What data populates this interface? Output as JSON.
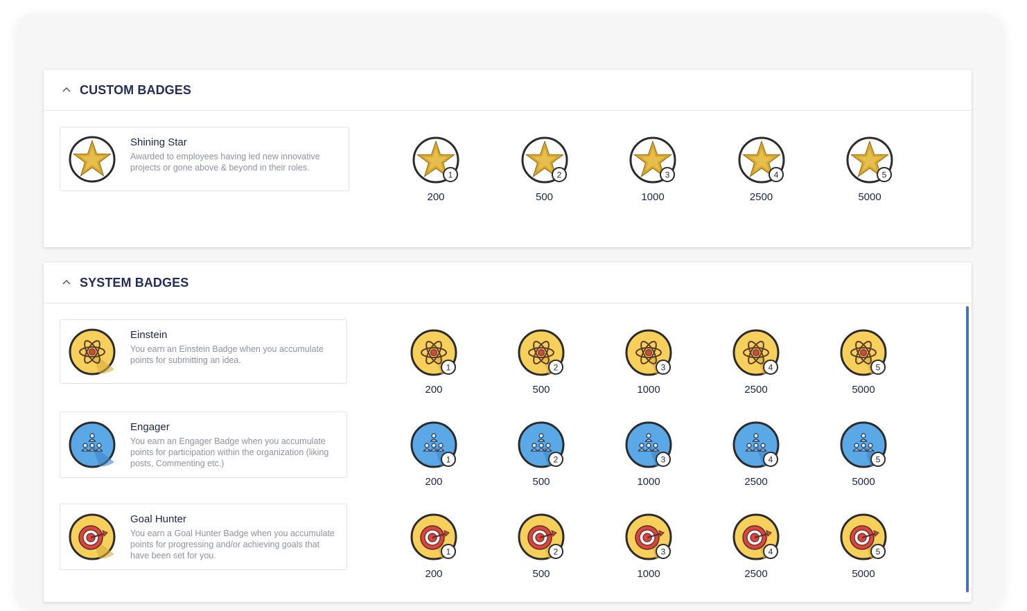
{
  "custom_section": {
    "title": "CUSTOM BADGES",
    "badges": [
      {
        "name": "Shining Star",
        "description": "Awarded to employees having led new innovative projects or gone above & beyond in their roles.",
        "icon": "star-badge-icon",
        "levels": [
          {
            "level": "1",
            "points": "200"
          },
          {
            "level": "2",
            "points": "500"
          },
          {
            "level": "3",
            "points": "1000"
          },
          {
            "level": "4",
            "points": "2500"
          },
          {
            "level": "5",
            "points": "5000"
          }
        ]
      }
    ]
  },
  "system_section": {
    "title": "SYSTEM BADGES",
    "badges": [
      {
        "name": "Einstein",
        "description": "You earn an Einstein Badge when you accumulate points for submitting an idea.",
        "icon": "atom-badge-icon",
        "levels": [
          {
            "level": "1",
            "points": "200"
          },
          {
            "level": "2",
            "points": "500"
          },
          {
            "level": "3",
            "points": "1000"
          },
          {
            "level": "4",
            "points": "2500"
          },
          {
            "level": "5",
            "points": "5000"
          }
        ]
      },
      {
        "name": "Engager",
        "description": "You earn an Engager Badge when you accumulate points for participation within the organization (liking posts, Commenting etc.)",
        "icon": "people-badge-icon",
        "levels": [
          {
            "level": "1",
            "points": "200"
          },
          {
            "level": "2",
            "points": "500"
          },
          {
            "level": "3",
            "points": "1000"
          },
          {
            "level": "4",
            "points": "2500"
          },
          {
            "level": "5",
            "points": "5000"
          }
        ]
      },
      {
        "name": "Goal Hunter",
        "description": "You earn a Goal Hunter Badge when you accumulate points for progressing and/or achieving goals that have been set for you.",
        "icon": "target-badge-icon",
        "levels": [
          {
            "level": "1",
            "points": "200"
          },
          {
            "level": "2",
            "points": "500"
          },
          {
            "level": "3",
            "points": "1000"
          },
          {
            "level": "4",
            "points": "2500"
          },
          {
            "level": "5",
            "points": "5000"
          }
        ]
      }
    ]
  },
  "colors": {
    "title": "#242c5a",
    "star_gold": "#d9a82a",
    "einstein_yellow": "#f7cf5b",
    "engager_blue": "#5aa8e6",
    "goal_yellow": "#f7cf5b",
    "scrollbar": "#4d6fb7"
  }
}
